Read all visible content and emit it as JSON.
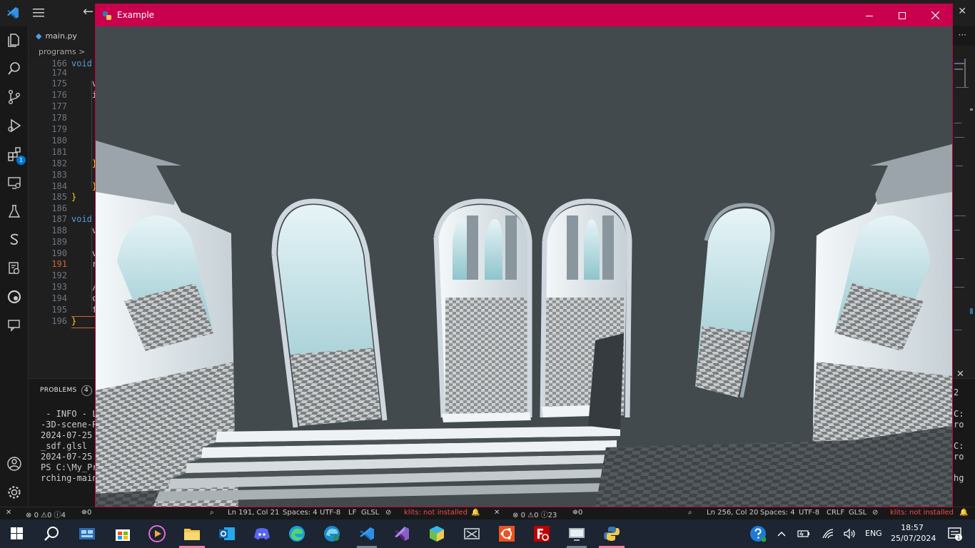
{
  "vscode": {
    "tab": "main.py",
    "breadcrumb": "programs >",
    "editor_lines": [
      {
        "n": "166",
        "code": "void "
      },
      {
        "n": "174",
        "code": ""
      },
      {
        "n": "175",
        "code": "    v"
      },
      {
        "n": "176",
        "code": "    i"
      },
      {
        "n": "177",
        "code": ""
      },
      {
        "n": "178",
        "code": ""
      },
      {
        "n": "179",
        "code": ""
      },
      {
        "n": "180",
        "code": ""
      },
      {
        "n": "181",
        "code": ""
      },
      {
        "n": "182",
        "code": "    }"
      },
      {
        "n": "183",
        "code": ""
      },
      {
        "n": "184",
        "code": "    }"
      },
      {
        "n": "185",
        "code": "}"
      },
      {
        "n": "186",
        "code": ""
      },
      {
        "n": "187",
        "code": "void "
      },
      {
        "n": "188",
        "code": "    v"
      },
      {
        "n": "189",
        "code": ""
      },
      {
        "n": "190",
        "code": "    v"
      },
      {
        "n": "191",
        "code": "    r"
      },
      {
        "n": "192",
        "code": ""
      },
      {
        "n": "193",
        "code": "    /"
      },
      {
        "n": "194",
        "code": "    c"
      },
      {
        "n": "195",
        "code": "    f"
      },
      {
        "n": "196",
        "code": "}"
      }
    ],
    "panel": {
      "tab_label": "PROBLEMS",
      "tab_count": "4",
      "terminal_lines": [
        " - INFO - L",
        "-3D-scene-R",
        "2024-07-25 ",
        "_sdf.glsl",
        "2024-07-25 ",
        "PS C:\\My_Pr",
        "rching-main"
      ],
      "right_lines": [
        "2",
        "C:",
        "ro",
        "",
        "C:",
        "ro",
        "",
        "hg"
      ]
    },
    "status_left": {
      "errors": "0",
      "warnings": "0",
      "info": "4",
      "ports": "0",
      "position": "Ln 191, Col 21",
      "spaces": "Spaces: 4",
      "encoding": "UTF-8",
      "eol": "LF",
      "language": "GLSL",
      "lint": "klits: not installed"
    },
    "status_right": {
      "errors": "0",
      "warnings": "0",
      "info": "23",
      "ports": "0",
      "position": "Ln 256, Col 20",
      "spaces": "Spaces: 4",
      "encoding": "UTF-8",
      "eol": "CRLF",
      "language": "GLSL",
      "lint": "klits: not installed"
    }
  },
  "example_window": {
    "title": "Example",
    "controls": [
      "minimize-icon",
      "maximize-icon",
      "close-icon"
    ]
  },
  "taskbar": {
    "apps": [
      "start-icon",
      "search-icon",
      "task-view-icon",
      "store-icon",
      "media-player-icon",
      "file-explorer-icon",
      "outlook-icon",
      "discord-icon",
      "edge-icon",
      "edge-beta-icon",
      "vscode-icon",
      "visual-studio-icon",
      "3d-viewer-icon",
      "snipping-tool-icon",
      "ubuntu-icon",
      "filezilla-icon",
      "remote-desktop-icon",
      "python-icon"
    ],
    "language": "ENG",
    "time": "18:57",
    "date": "25/07/2024",
    "notifications": "1"
  },
  "colors": {
    "window_title_bar": "#c8004e",
    "vscode_accent": "#0078d4",
    "status_error": "#f14c4c"
  }
}
